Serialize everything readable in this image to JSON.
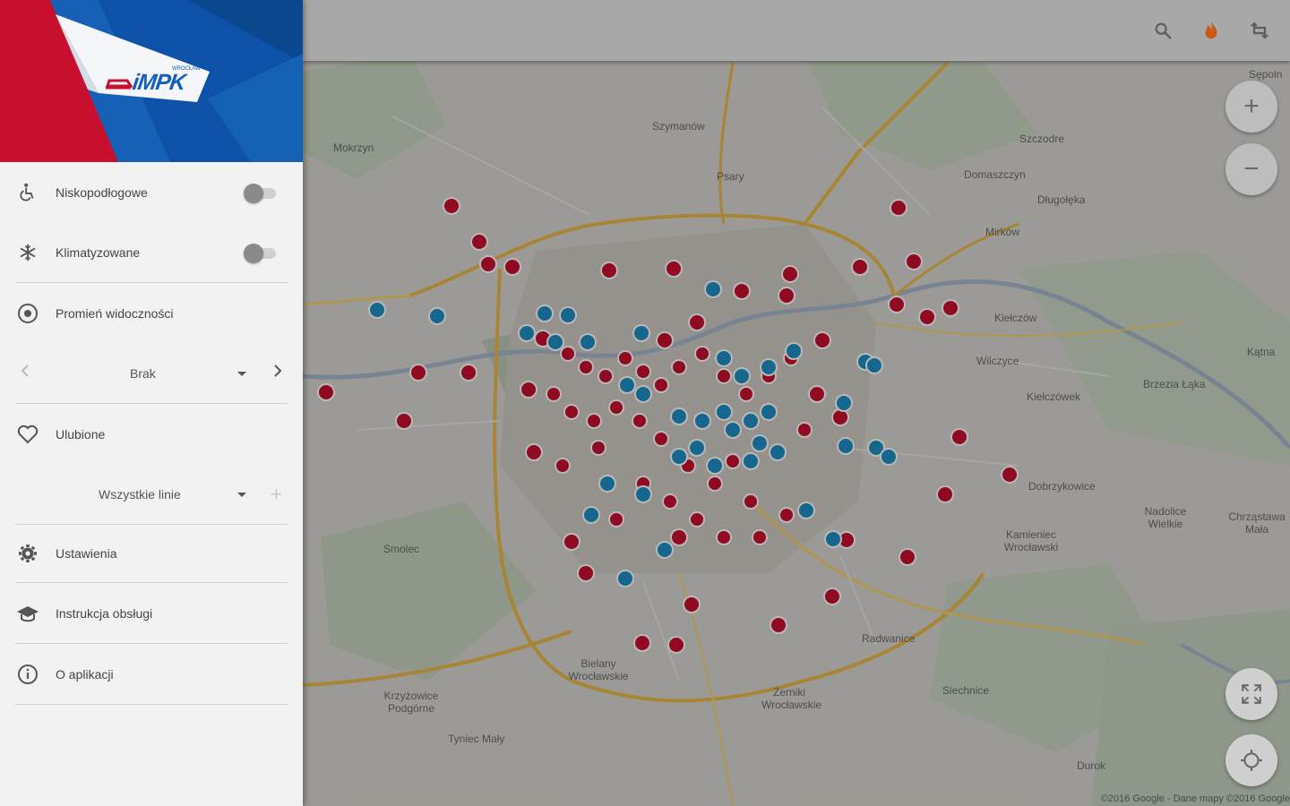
{
  "drawer": {
    "logo": {
      "brand": "iMPK",
      "small_text": "WROCŁAW"
    },
    "items": [
      {
        "id": "low-floor",
        "label": "Niskopodłogowe",
        "icon": "wheelchair-icon",
        "toggle": false
      },
      {
        "id": "air-conditioned",
        "label": "Klimatyzowane",
        "icon": "snowflake-icon",
        "toggle": false
      },
      {
        "id": "visibility-radius",
        "label": "Promień widoczności",
        "icon": "radio-target-icon"
      }
    ],
    "radius_select": {
      "value": "Brak"
    },
    "favorites": {
      "label": "Ulubione",
      "icon": "heart-icon"
    },
    "lines_select": {
      "value": "Wszystkie linie"
    },
    "settings": {
      "label": "Ustawienia",
      "icon": "gear-icon"
    },
    "manual": {
      "label": "Instrukcja obsługi",
      "icon": "graduation-cap-icon"
    },
    "about": {
      "label": "O aplikacji",
      "icon": "info-icon"
    }
  },
  "toolbar": {
    "icons": [
      "search-icon",
      "flame-icon",
      "refresh-icon"
    ]
  },
  "map": {
    "zoom_in": "+",
    "zoom_out": "−",
    "copyright": "©2016 Google - Dane mapy ©2016 Google",
    "places": [
      "Szymanów",
      "Psary",
      "Szczodre",
      "Domaszczyn",
      "Długołęka",
      "Mirków",
      "Kiełczów",
      "Wilczyce",
      "Kiełczówek",
      "Brzezia Łąka",
      "Kątna",
      "Dobrzykowice",
      "Nadolice Wielkie",
      "Chrząstawa Mała",
      "Kamieniec Wrocławski",
      "Radwanice",
      "Siechnice",
      "Żerniki Wrocławskie",
      "Bielany Wrocławskie",
      "Smolec",
      "Krzyżowice Podgórne",
      "Tyniec Mały",
      "Mokrzyn",
      "Sępoln",
      "Durok"
    ]
  }
}
